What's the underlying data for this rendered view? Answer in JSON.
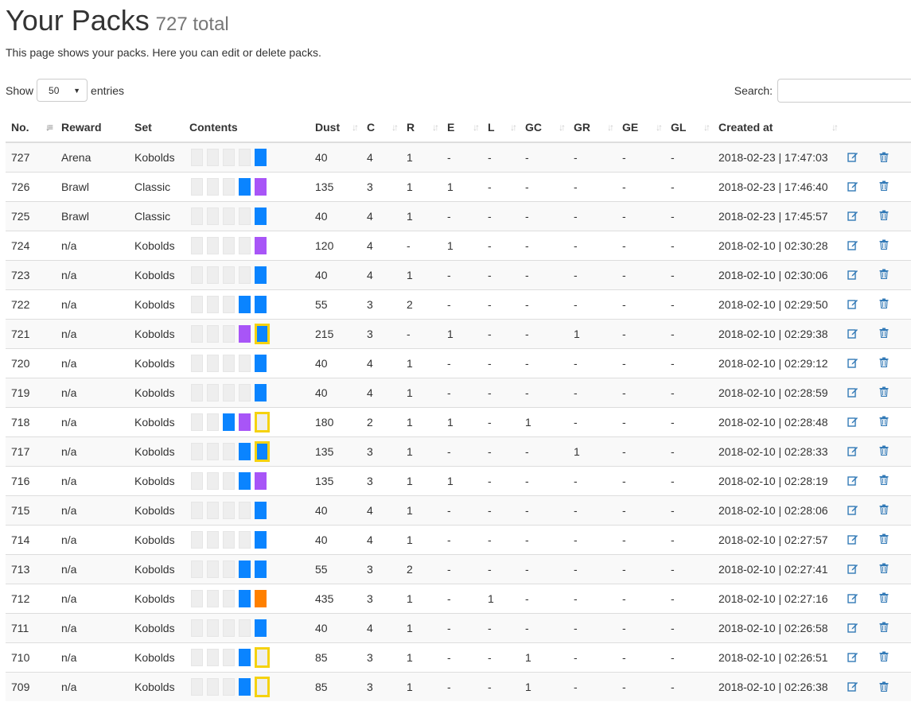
{
  "header": {
    "title": "Your Packs",
    "count": "727 total"
  },
  "description": "This page shows your packs. Here you can edit or delete packs.",
  "controls": {
    "show_label": "Show",
    "entries_value": "50",
    "entries_label": "entries",
    "search_label": "Search:",
    "search_value": ""
  },
  "columns": [
    "No.",
    "Reward",
    "Set",
    "Contents",
    "Dust",
    "C",
    "R",
    "E",
    "L",
    "GC",
    "GR",
    "GE",
    "GL",
    "Created at"
  ],
  "rows": [
    {
      "no": "727",
      "reward": "Arena",
      "set": "Kobolds",
      "cards": [
        "common",
        "common",
        "common",
        "common",
        "rare"
      ],
      "dust": "40",
      "c": "4",
      "r": "1",
      "e": "-",
      "l": "-",
      "gc": "-",
      "gr": "-",
      "ge": "-",
      "gl": "-",
      "created": "2018-02-23 | 17:47:03"
    },
    {
      "no": "726",
      "reward": "Brawl",
      "set": "Classic",
      "cards": [
        "common",
        "common",
        "common",
        "rare",
        "epic"
      ],
      "dust": "135",
      "c": "3",
      "r": "1",
      "e": "1",
      "l": "-",
      "gc": "-",
      "gr": "-",
      "ge": "-",
      "gl": "-",
      "created": "2018-02-23 | 17:46:40"
    },
    {
      "no": "725",
      "reward": "Brawl",
      "set": "Classic",
      "cards": [
        "common",
        "common",
        "common",
        "common",
        "rare"
      ],
      "dust": "40",
      "c": "4",
      "r": "1",
      "e": "-",
      "l": "-",
      "gc": "-",
      "gr": "-",
      "ge": "-",
      "gl": "-",
      "created": "2018-02-23 | 17:45:57"
    },
    {
      "no": "724",
      "reward": "n/a",
      "set": "Kobolds",
      "cards": [
        "common",
        "common",
        "common",
        "common",
        "epic"
      ],
      "dust": "120",
      "c": "4",
      "r": "-",
      "e": "1",
      "l": "-",
      "gc": "-",
      "gr": "-",
      "ge": "-",
      "gl": "-",
      "created": "2018-02-10 | 02:30:28"
    },
    {
      "no": "723",
      "reward": "n/a",
      "set": "Kobolds",
      "cards": [
        "common",
        "common",
        "common",
        "common",
        "rare"
      ],
      "dust": "40",
      "c": "4",
      "r": "1",
      "e": "-",
      "l": "-",
      "gc": "-",
      "gr": "-",
      "ge": "-",
      "gl": "-",
      "created": "2018-02-10 | 02:30:06"
    },
    {
      "no": "722",
      "reward": "n/a",
      "set": "Kobolds",
      "cards": [
        "common",
        "common",
        "common",
        "rare",
        "rare"
      ],
      "dust": "55",
      "c": "3",
      "r": "2",
      "e": "-",
      "l": "-",
      "gc": "-",
      "gr": "-",
      "ge": "-",
      "gl": "-",
      "created": "2018-02-10 | 02:29:50"
    },
    {
      "no": "721",
      "reward": "n/a",
      "set": "Kobolds",
      "cards": [
        "common",
        "common",
        "common",
        "epic",
        "golden-rare"
      ],
      "dust": "215",
      "c": "3",
      "r": "-",
      "e": "1",
      "l": "-",
      "gc": "-",
      "gr": "1",
      "ge": "-",
      "gl": "-",
      "created": "2018-02-10 | 02:29:38"
    },
    {
      "no": "720",
      "reward": "n/a",
      "set": "Kobolds",
      "cards": [
        "common",
        "common",
        "common",
        "common",
        "rare"
      ],
      "dust": "40",
      "c": "4",
      "r": "1",
      "e": "-",
      "l": "-",
      "gc": "-",
      "gr": "-",
      "ge": "-",
      "gl": "-",
      "created": "2018-02-10 | 02:29:12"
    },
    {
      "no": "719",
      "reward": "n/a",
      "set": "Kobolds",
      "cards": [
        "common",
        "common",
        "common",
        "common",
        "rare"
      ],
      "dust": "40",
      "c": "4",
      "r": "1",
      "e": "-",
      "l": "-",
      "gc": "-",
      "gr": "-",
      "ge": "-",
      "gl": "-",
      "created": "2018-02-10 | 02:28:59"
    },
    {
      "no": "718",
      "reward": "n/a",
      "set": "Kobolds",
      "cards": [
        "common",
        "common",
        "rare",
        "epic",
        "golden-common"
      ],
      "dust": "180",
      "c": "2",
      "r": "1",
      "e": "1",
      "l": "-",
      "gc": "1",
      "gr": "-",
      "ge": "-",
      "gl": "-",
      "created": "2018-02-10 | 02:28:48"
    },
    {
      "no": "717",
      "reward": "n/a",
      "set": "Kobolds",
      "cards": [
        "common",
        "common",
        "common",
        "rare",
        "golden-rare"
      ],
      "dust": "135",
      "c": "3",
      "r": "1",
      "e": "-",
      "l": "-",
      "gc": "-",
      "gr": "1",
      "ge": "-",
      "gl": "-",
      "created": "2018-02-10 | 02:28:33"
    },
    {
      "no": "716",
      "reward": "n/a",
      "set": "Kobolds",
      "cards": [
        "common",
        "common",
        "common",
        "rare",
        "epic"
      ],
      "dust": "135",
      "c": "3",
      "r": "1",
      "e": "1",
      "l": "-",
      "gc": "-",
      "gr": "-",
      "ge": "-",
      "gl": "-",
      "created": "2018-02-10 | 02:28:19"
    },
    {
      "no": "715",
      "reward": "n/a",
      "set": "Kobolds",
      "cards": [
        "common",
        "common",
        "common",
        "common",
        "rare"
      ],
      "dust": "40",
      "c": "4",
      "r": "1",
      "e": "-",
      "l": "-",
      "gc": "-",
      "gr": "-",
      "ge": "-",
      "gl": "-",
      "created": "2018-02-10 | 02:28:06"
    },
    {
      "no": "714",
      "reward": "n/a",
      "set": "Kobolds",
      "cards": [
        "common",
        "common",
        "common",
        "common",
        "rare"
      ],
      "dust": "40",
      "c": "4",
      "r": "1",
      "e": "-",
      "l": "-",
      "gc": "-",
      "gr": "-",
      "ge": "-",
      "gl": "-",
      "created": "2018-02-10 | 02:27:57"
    },
    {
      "no": "713",
      "reward": "n/a",
      "set": "Kobolds",
      "cards": [
        "common",
        "common",
        "common",
        "rare",
        "rare"
      ],
      "dust": "55",
      "c": "3",
      "r": "2",
      "e": "-",
      "l": "-",
      "gc": "-",
      "gr": "-",
      "ge": "-",
      "gl": "-",
      "created": "2018-02-10 | 02:27:41"
    },
    {
      "no": "712",
      "reward": "n/a",
      "set": "Kobolds",
      "cards": [
        "common",
        "common",
        "common",
        "rare",
        "legendary"
      ],
      "dust": "435",
      "c": "3",
      "r": "1",
      "e": "-",
      "l": "1",
      "gc": "-",
      "gr": "-",
      "ge": "-",
      "gl": "-",
      "created": "2018-02-10 | 02:27:16"
    },
    {
      "no": "711",
      "reward": "n/a",
      "set": "Kobolds",
      "cards": [
        "common",
        "common",
        "common",
        "common",
        "rare"
      ],
      "dust": "40",
      "c": "4",
      "r": "1",
      "e": "-",
      "l": "-",
      "gc": "-",
      "gr": "-",
      "ge": "-",
      "gl": "-",
      "created": "2018-02-10 | 02:26:58"
    },
    {
      "no": "710",
      "reward": "n/a",
      "set": "Kobolds",
      "cards": [
        "common",
        "common",
        "common",
        "rare",
        "golden-common"
      ],
      "dust": "85",
      "c": "3",
      "r": "1",
      "e": "-",
      "l": "-",
      "gc": "1",
      "gr": "-",
      "ge": "-",
      "gl": "-",
      "created": "2018-02-10 | 02:26:51"
    },
    {
      "no": "709",
      "reward": "n/a",
      "set": "Kobolds",
      "cards": [
        "common",
        "common",
        "common",
        "rare",
        "golden-common"
      ],
      "dust": "85",
      "c": "3",
      "r": "1",
      "e": "-",
      "l": "-",
      "gc": "1",
      "gr": "-",
      "ge": "-",
      "gl": "-",
      "created": "2018-02-10 | 02:26:38"
    }
  ],
  "icons": {
    "edit": "edit-icon",
    "delete": "trash-icon",
    "sort": "sort-icon"
  },
  "colors": {
    "rare": "#0a84ff",
    "epic": "#a855f7",
    "legendary": "#ff8000",
    "golden_border": "#f5d20f",
    "action_icon": "#337ab7"
  }
}
